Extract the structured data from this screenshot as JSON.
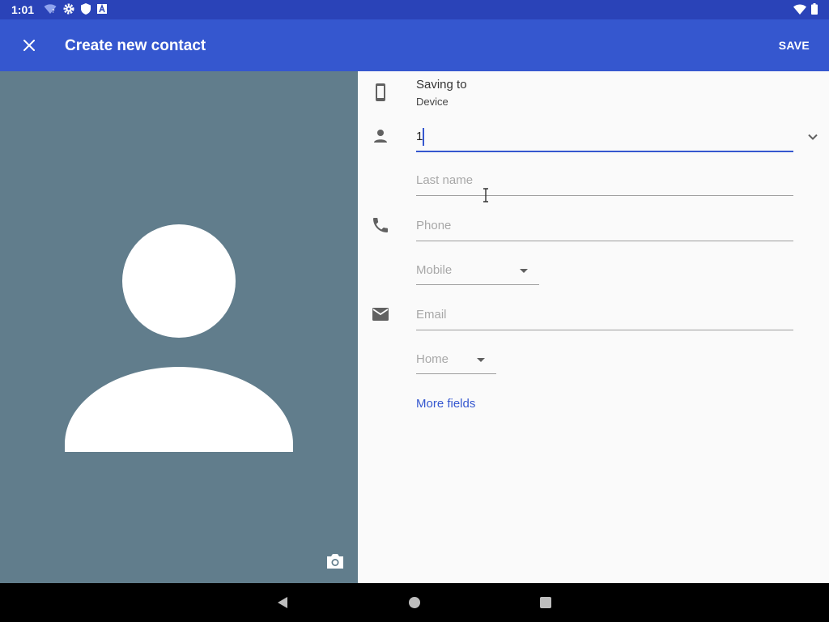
{
  "status_bar": {
    "time": "1:01",
    "left_icons": [
      "wifi-question-icon",
      "settings-icon",
      "shield-icon",
      "a-icon"
    ],
    "right_icons": [
      "wifi-icon",
      "battery-icon"
    ]
  },
  "app_bar": {
    "title": "Create new contact",
    "save_label": "SAVE",
    "close_icon": "close-icon",
    "background": "#3557cf"
  },
  "photo": {
    "background": "#617d8c",
    "camera_icon": "camera-icon"
  },
  "form": {
    "saving_to": {
      "title": "Saving to",
      "subtitle": "Device"
    },
    "first_name": {
      "value": "1"
    },
    "last_name": {
      "placeholder": "Last name"
    },
    "phone": {
      "placeholder": "Phone",
      "type_label": "Mobile"
    },
    "email": {
      "placeholder": "Email",
      "type_label": "Home"
    },
    "more_fields_label": "More fields"
  },
  "colors": {
    "accent": "#3557cf",
    "status_bar": "#2a43b8"
  }
}
